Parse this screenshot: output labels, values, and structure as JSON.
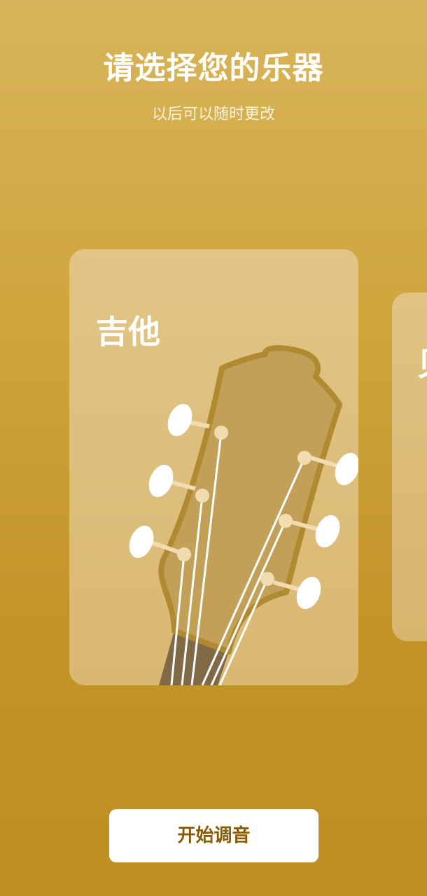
{
  "header": {
    "title": "请选择您的乐器",
    "subtitle": "以后可以随时更改"
  },
  "instruments": [
    {
      "label": "吉他",
      "icon": "guitar-headstock-icon",
      "selected": true
    },
    {
      "label": "贝",
      "icon": "",
      "selected": false
    }
  ],
  "actions": {
    "start_label": "开始调音"
  },
  "colors": {
    "background_top": "#d8b55a",
    "background_bottom": "#bd8f22",
    "card": "#dcbd7b",
    "headstock": "#c2a057",
    "headstock_outline": "#b08a30",
    "button_text": "#8a5a00"
  }
}
